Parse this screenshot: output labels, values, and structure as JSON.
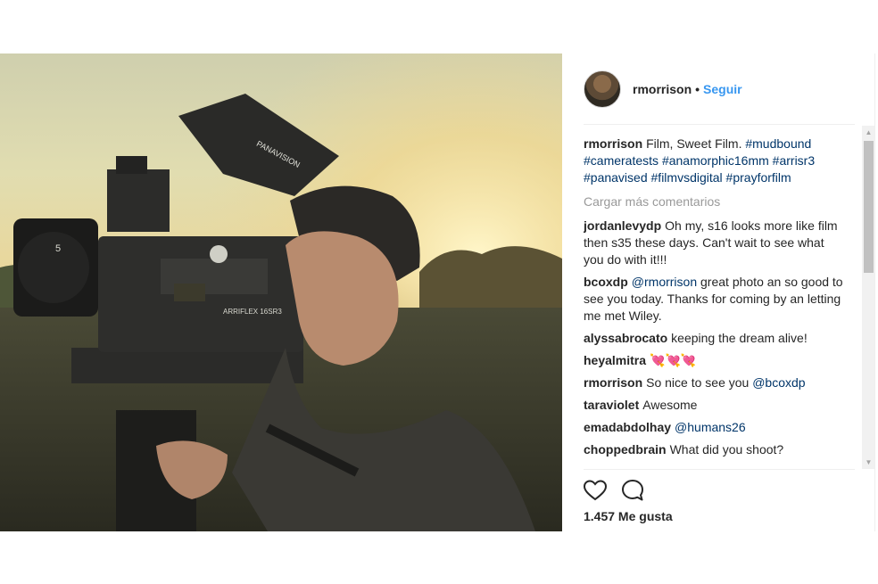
{
  "post": {
    "username": "rmorrison",
    "separator": "•",
    "follow_label": "Seguir",
    "likes_text": "1.457 Me gusta",
    "camera_body_text": "ARRIFLEX 16SR3",
    "monitor_brand_text": "PANAVISION",
    "lens_text": "5"
  },
  "caption": {
    "username": "rmorrison",
    "text": "Film, Sweet Film.",
    "hashtags": [
      "#mudbound",
      "#cameratests",
      "#anamorphic16mm",
      "#arrisr3",
      "#panavised",
      "#filmvsdigital",
      "#prayforfilm"
    ]
  },
  "load_more_label": "Cargar más comentarios",
  "comments": [
    {
      "username": "jordanlevydp",
      "text": "Oh my, s16 looks more like film then s35 these days. Can't wait to see what you do with it!!!"
    },
    {
      "username": "bcoxdp",
      "mention": "@rmorrison",
      "text": "great photo an so good to see you today. Thanks for coming by an letting me met Wiley."
    },
    {
      "username": "alyssabrocato",
      "text": "keeping the dream alive!"
    },
    {
      "username": "heyalmitra",
      "text": "💘💘💘"
    },
    {
      "username": "rmorrison",
      "text": "So nice to see you",
      "mention": "@bcoxdp"
    },
    {
      "username": "taraviolet",
      "text": "Awesome"
    },
    {
      "username": "emadabdolhay",
      "mention": "@humans26"
    },
    {
      "username": "choppedbrain",
      "text": "What did you shoot?"
    }
  ],
  "icons": {
    "like": "heart-outline-icon",
    "comment": "speech-bubble-icon",
    "scroll_up": "▲",
    "scroll_down": "▼"
  },
  "colors": {
    "link": "#3897f0",
    "hashtag": "#003569",
    "muted": "#999999",
    "text": "#262626"
  }
}
